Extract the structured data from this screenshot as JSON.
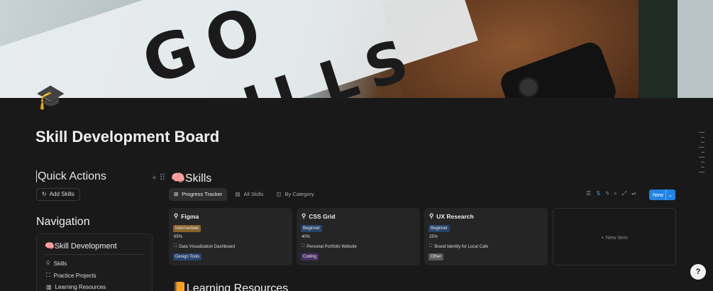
{
  "cover": {
    "letters_top": "GO",
    "letters_bottom": "ILLS"
  },
  "page": {
    "icon": "🎓",
    "title": "Skill Development Board"
  },
  "left": {
    "quick_actions_title": "Quick Actions",
    "add_skills_label": "Add Skills",
    "navigation_title": "Navigation",
    "nav_header": "🧠Skill Development",
    "nav_items": [
      {
        "label": "Skills",
        "icon": "lightbulb-icon"
      },
      {
        "label": "Practice Projects",
        "icon": "frame-icon"
      },
      {
        "label": "Learning Resources",
        "icon": "book-icon"
      }
    ]
  },
  "skills": {
    "heading": "🧠Skills",
    "tabs": [
      {
        "label": "Progress Tracker",
        "icon": "gallery-icon",
        "active": true
      },
      {
        "label": "All Skills",
        "icon": "table-icon",
        "active": false
      },
      {
        "label": "By Category",
        "icon": "board-icon",
        "active": false
      }
    ],
    "new_label": "New",
    "cards": [
      {
        "name": "Figma",
        "level": "Intermediate",
        "level_color": "#89632a",
        "progress": "65%",
        "project": "Data Visualization Dashboard",
        "category": "Design Tools",
        "category_color": "#28456c"
      },
      {
        "name": "CSS Grid",
        "level": "Beginner",
        "level_color": "#28456c",
        "progress": "40%",
        "project": "Personal Portfolio Website",
        "category": "Coding",
        "category_color": "#492f64"
      },
      {
        "name": "UX Research",
        "level": "Beginner",
        "level_color": "#28456c",
        "progress": "25%",
        "project": "Brand Identity for Local Cafe",
        "category": "Other",
        "category_color": "#5a5a5a"
      }
    ],
    "new_item_label": "+ New item"
  },
  "resources_heading": "📙Learning Resources",
  "help_label": "?"
}
